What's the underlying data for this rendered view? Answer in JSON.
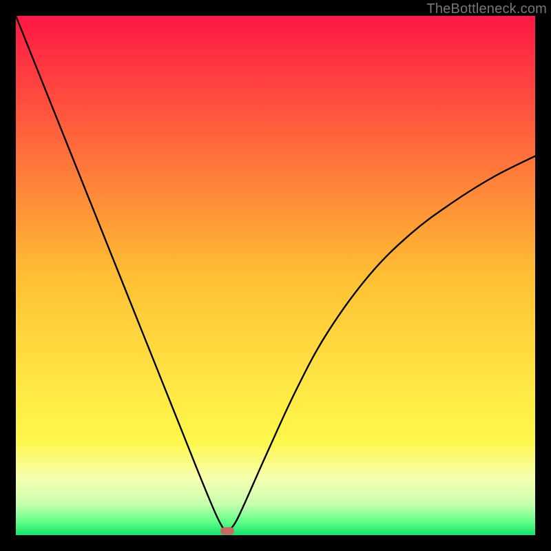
{
  "watermark": "TheBottleneck.com",
  "chart_data": {
    "type": "line",
    "title": "",
    "xlabel": "",
    "ylabel": "",
    "xlim": [
      0,
      100
    ],
    "ylim": [
      0,
      100
    ],
    "grid": false,
    "legend": false,
    "background_gradient": {
      "stops": [
        {
          "pos": 0.0,
          "color": "#ff1744"
        },
        {
          "pos": 0.25,
          "color": "#ff6a3c"
        },
        {
          "pos": 0.5,
          "color": "#ffbf33"
        },
        {
          "pos": 0.7,
          "color": "#ffe544"
        },
        {
          "pos": 0.82,
          "color": "#fff84a"
        },
        {
          "pos": 0.89,
          "color": "#f7ffb0"
        },
        {
          "pos": 0.94,
          "color": "#c8ffb0"
        },
        {
          "pos": 0.975,
          "color": "#5eff87"
        },
        {
          "pos": 1.0,
          "color": "#14e06c"
        }
      ]
    },
    "series": [
      {
        "name": "bottleneck-curve",
        "color": "#000000",
        "x": [
          0,
          4,
          8,
          12,
          16,
          20,
          24,
          28,
          32,
          36,
          39,
          40.5,
          42,
          44,
          48,
          54,
          60,
          68,
          76,
          84,
          92,
          100
        ],
        "y": [
          100,
          90,
          80,
          70,
          60,
          50,
          40,
          30,
          20,
          10,
          3,
          1,
          2,
          6,
          15,
          28,
          39,
          50,
          58,
          64,
          69,
          73
        ]
      }
    ],
    "marker": {
      "x": 40.7,
      "y": 0.8,
      "color": "#c66a64"
    }
  }
}
